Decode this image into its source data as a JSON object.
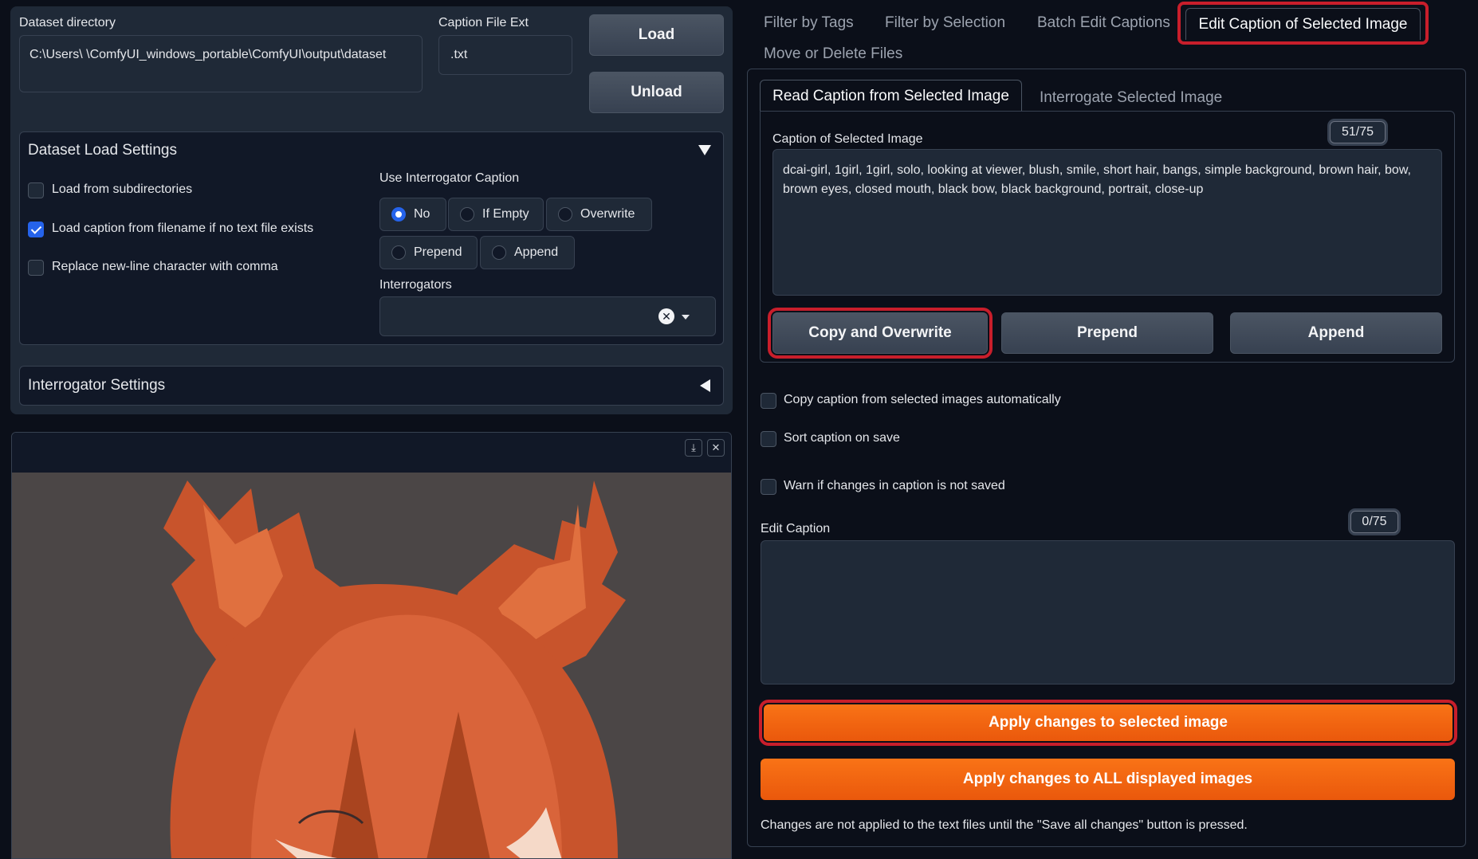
{
  "left": {
    "dataset_directory_label": "Dataset directory",
    "dataset_directory_value": "C:\\Users\\        \\ComfyUI_windows_portable\\ComfyUI\\output\\dataset",
    "caption_ext_label": "Caption File Ext",
    "caption_ext_value": ".txt",
    "load_label": "Load",
    "unload_label": "Unload",
    "load_settings": {
      "title": "Dataset Load Settings",
      "checkboxes": [
        {
          "label": "Load from subdirectories",
          "checked": false
        },
        {
          "label": "Load caption from filename if no text file exists",
          "checked": true
        },
        {
          "label": "Replace new-line character with comma",
          "checked": false
        }
      ],
      "interrogator_caption_label": "Use Interrogator Caption",
      "radio_options": [
        "No",
        "If Empty",
        "Overwrite",
        "Prepend",
        "Append"
      ],
      "radio_selected": "No",
      "interrogators_label": "Interrogators"
    },
    "interrogator_settings_title": "Interrogator Settings"
  },
  "right": {
    "tabs": [
      "Filter by Tags",
      "Filter by Selection",
      "Batch Edit Captions",
      "Edit Caption of Selected Image",
      "Move or Delete Files"
    ],
    "active_tab": "Edit Caption of Selected Image",
    "subtabs": [
      "Read Caption from Selected Image",
      "Interrogate Selected Image"
    ],
    "caption_label": "Caption of Selected Image",
    "caption_counter": "51/75",
    "caption_text": "dcai-girl, 1girl, 1girl, solo, looking at viewer, blush, smile, short hair, bangs, simple background, brown hair, bow, brown eyes, closed mouth, black bow, black background, portrait, close-up",
    "copy_overwrite_label": "Copy and Overwrite",
    "prepend_label": "Prepend",
    "append_label": "Append",
    "options": [
      {
        "label": "Copy caption from selected images automatically",
        "checked": false
      },
      {
        "label": "Sort caption on save",
        "checked": false
      },
      {
        "label": "Warn if changes in caption is not saved",
        "checked": false
      }
    ],
    "edit_caption_label": "Edit Caption",
    "edit_counter": "0/75",
    "edit_caption_value": "",
    "apply_selected_label": "Apply changes to selected image",
    "apply_all_label": "Apply changes to ALL displayed images",
    "note": "Changes are not applied to the text files until the \"Save all changes\" button is pressed."
  },
  "colors": {
    "background": "#0b0f19",
    "panel": "#1f2937",
    "accent_orange": "#f97316",
    "highlight_red": "#c81e2b",
    "checkbox_blue": "#2563eb"
  }
}
